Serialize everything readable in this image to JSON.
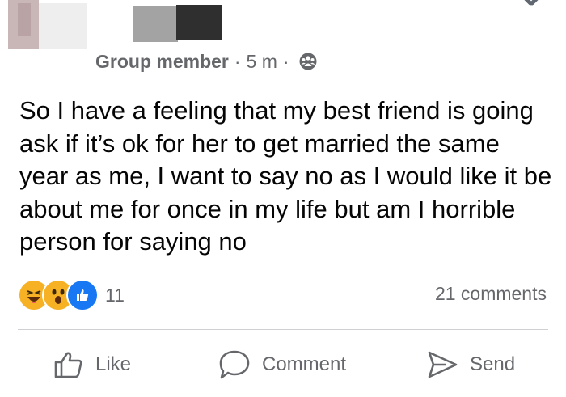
{
  "post": {
    "author": "Group member",
    "time": "5 m",
    "separator": "·",
    "text": "So I have a feeling that my best friend is going ask if it’s ok for her to get married the same year as me, I want to say no as I would like it be about me for once in my life but am I horrible person for saying no"
  },
  "reactions": {
    "types": [
      "haha",
      "wow",
      "like"
    ],
    "count": "11"
  },
  "comments_label": "21 comments",
  "actions": {
    "like": "Like",
    "comment": "Comment",
    "send": "Send"
  },
  "colors": {
    "meta_text": "#65676b",
    "like_blue": "#1877f2",
    "emoji_yellow": "#f7b125"
  }
}
